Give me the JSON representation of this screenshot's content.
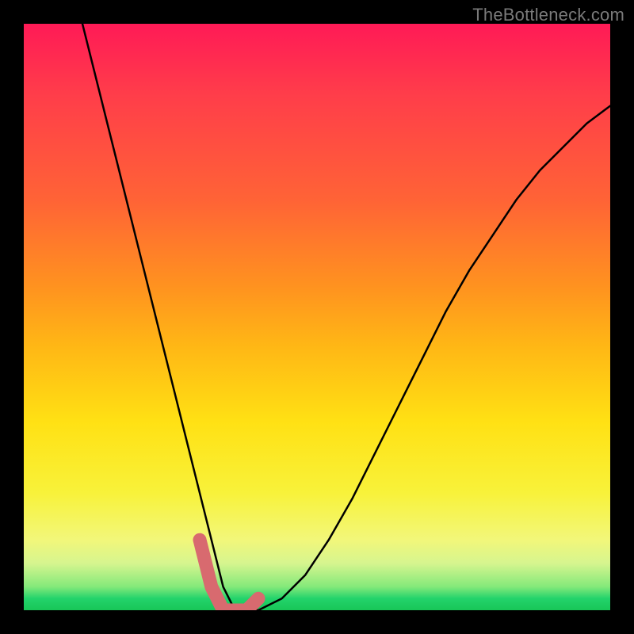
{
  "watermark": "TheBottleneck.com",
  "chart_data": {
    "type": "line",
    "title": "",
    "xlabel": "",
    "ylabel": "",
    "xlim": [
      0,
      100
    ],
    "ylim": [
      0,
      100
    ],
    "series": [
      {
        "name": "bottleneck-curve",
        "x": [
          10,
          12,
          14,
          16,
          18,
          20,
          22,
          24,
          26,
          28,
          30,
          32,
          34,
          36,
          38,
          40,
          44,
          48,
          52,
          56,
          60,
          64,
          68,
          72,
          76,
          80,
          84,
          88,
          92,
          96,
          100
        ],
        "values": [
          100,
          92,
          84,
          76,
          68,
          60,
          52,
          44,
          36,
          28,
          20,
          12,
          4,
          0,
          0,
          0,
          2,
          6,
          12,
          19,
          27,
          35,
          43,
          51,
          58,
          64,
          70,
          75,
          79,
          83,
          86
        ]
      },
      {
        "name": "highlight-band",
        "x": [
          30,
          32,
          34,
          36,
          38,
          40
        ],
        "values": [
          12,
          4,
          0,
          0,
          0,
          2
        ]
      }
    ],
    "annotations": [],
    "grid": false,
    "legend": false
  },
  "colors": {
    "curve": "#000000",
    "highlight": "#d86a6f",
    "frame": "#000000"
  }
}
